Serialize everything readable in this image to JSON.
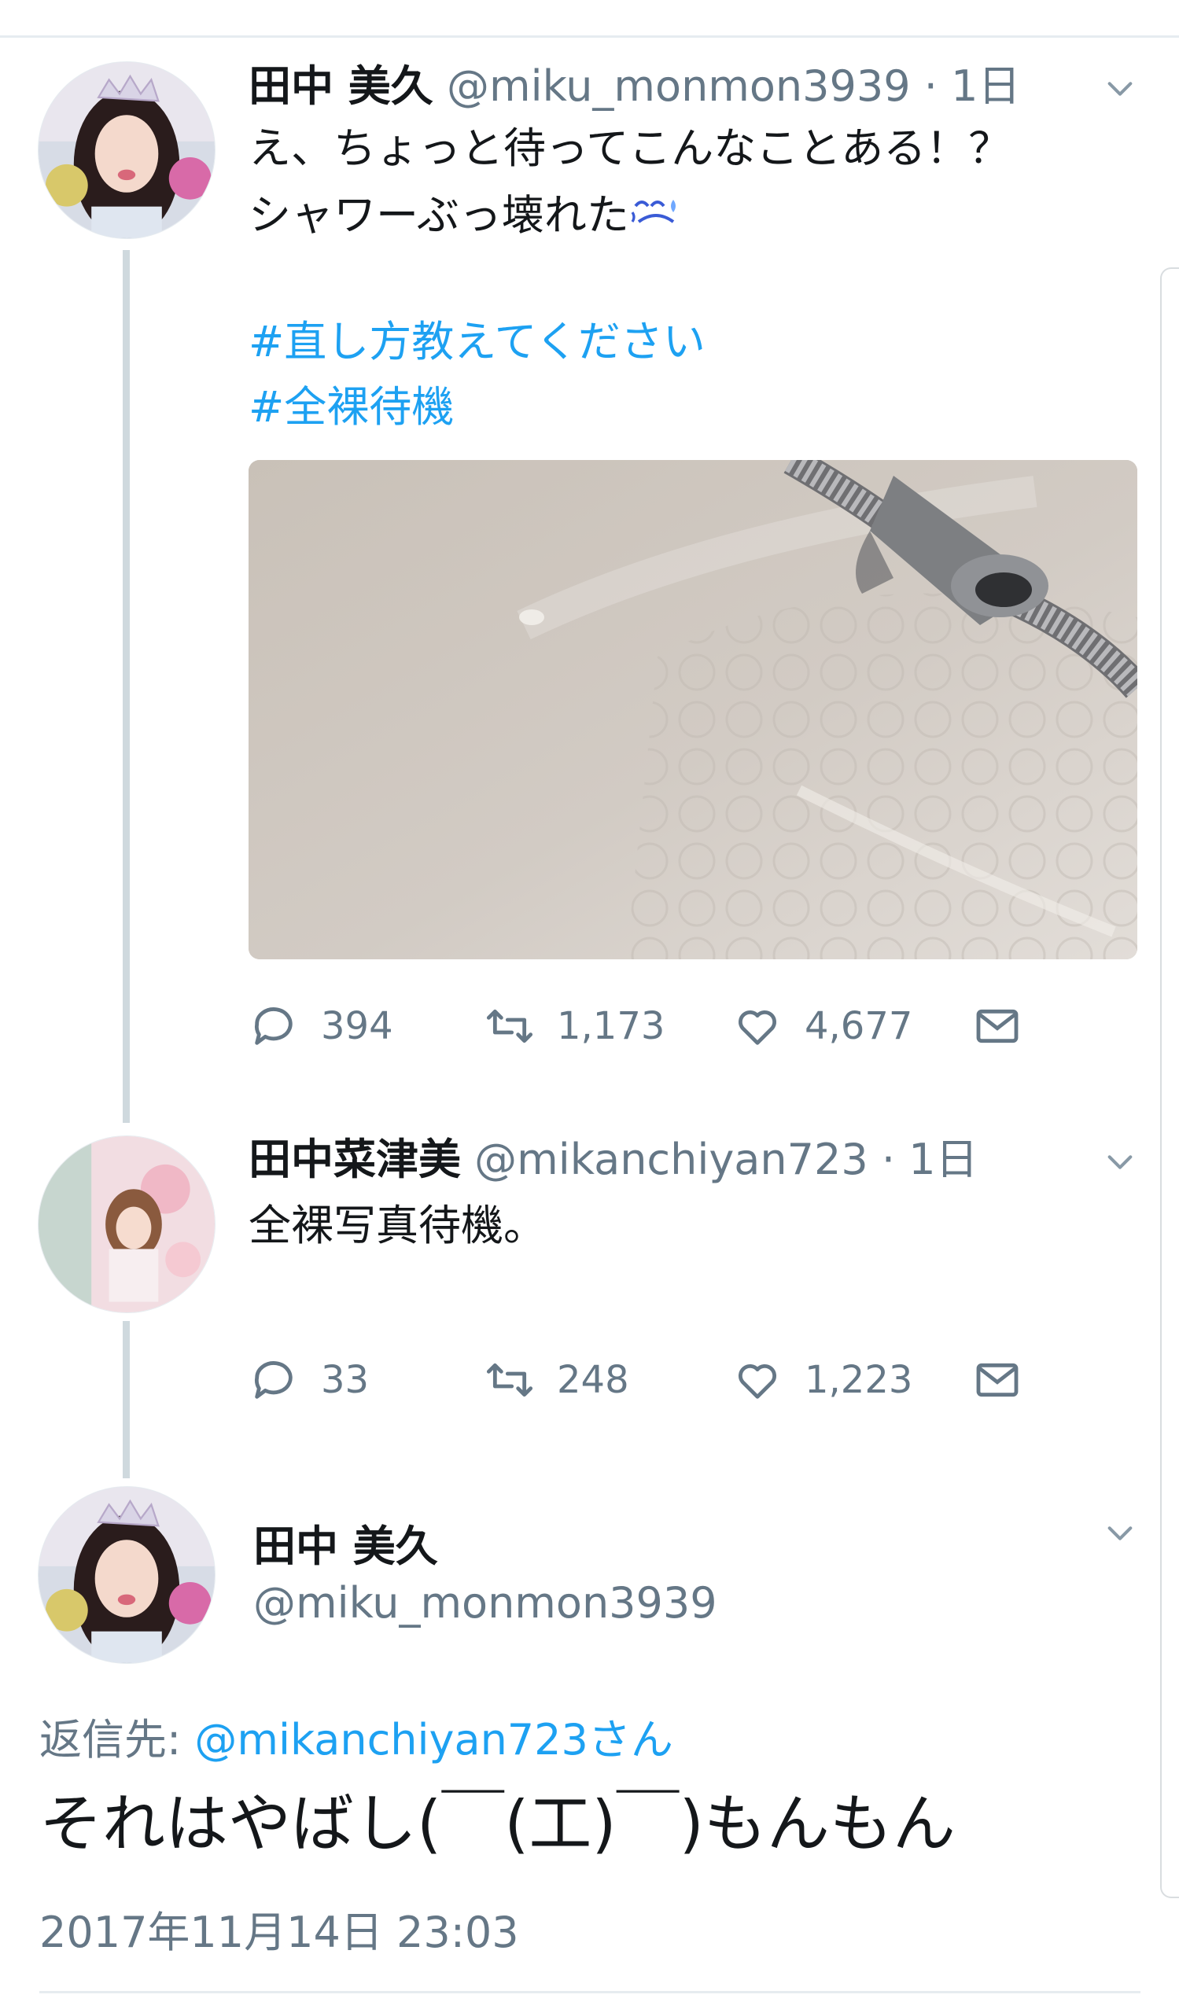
{
  "tweet1": {
    "name": "田中 美久",
    "handle": "@miku_monmon3939",
    "time": "· 1日",
    "line1": "え、ちょっと待ってこんなことある！？",
    "line2": "シャワーぶっ壊れた",
    "emoji": "sweat-emoji",
    "hashtags": [
      "#直し方教えてください",
      "#全裸待機"
    ],
    "reply_count": "394",
    "retweet_count": "1,173",
    "like_count": "4,677"
  },
  "tweet2": {
    "name": "田中菜津美",
    "handle": "@mikanchiyan723",
    "time": "· 1日",
    "text": "全裸写真待機。",
    "reply_count": "33",
    "retweet_count": "248",
    "like_count": "1,223"
  },
  "detail": {
    "name": "田中 美久",
    "handle": "@miku_monmon3939",
    "reply_prefix": "返信先: ",
    "reply_to": "@mikanchiyan723さん",
    "text": "それはやばし(￣(工)￣)もんもん",
    "timestamp": "2017年11月14日 23:03"
  },
  "icons": {
    "reply": "reply-icon",
    "retweet": "retweet-icon",
    "like": "heart-icon",
    "dm": "envelope-icon",
    "chevron": "chevron-down-icon"
  },
  "colors": {
    "link": "#1da1f2",
    "secondary_text": "#657786",
    "thread_line": "#cfd9de"
  }
}
